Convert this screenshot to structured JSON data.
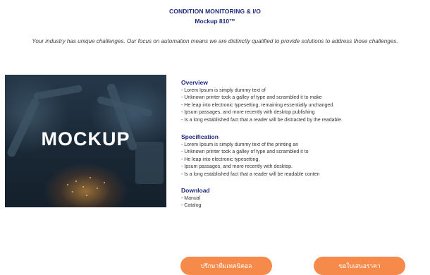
{
  "header": {
    "title": "CONDITION MONITORING & I/O",
    "subtitle": "Mockup 810™"
  },
  "tagline": "Your industry has unique challenges. Our focus on automation means we are distinctly qualified to provide solutions to address those challenges.",
  "hero": {
    "text": "MOCKUP"
  },
  "overview": {
    "heading": "Overview",
    "lines": [
      "- Lorem Ipsum is simply dummy text of",
      "- Unknown printer took a galley of type and scrambled it to make",
      "- He leap into electronic typesetting, remaining essentially unchanged.",
      "- Ipsum passages, and more recently with desktop publishing",
      "- Is a long established fact that a reader will be distracted by the readable."
    ]
  },
  "specification": {
    "heading": "Specification",
    "lines": [
      "- Lorem Ipsum is simply dummy text of the printing an",
      "- Unknown printer took a galley of type and scrambled it to",
      "- He leap into electronic typesetting,",
      "- Ipsum passages, and more recently with desktop.",
      "- Is a long established fact that a reader will be readable conten"
    ]
  },
  "download": {
    "heading": "Download",
    "links": [
      "- Manual",
      "- Catalog"
    ]
  },
  "buttons": {
    "consult": "ปรึกษาทีมเทคนิคอล",
    "quote": "ขอใบเสนอราคา"
  },
  "colors": {
    "heading": "#1f2a7a",
    "button": "#f58a4a"
  }
}
